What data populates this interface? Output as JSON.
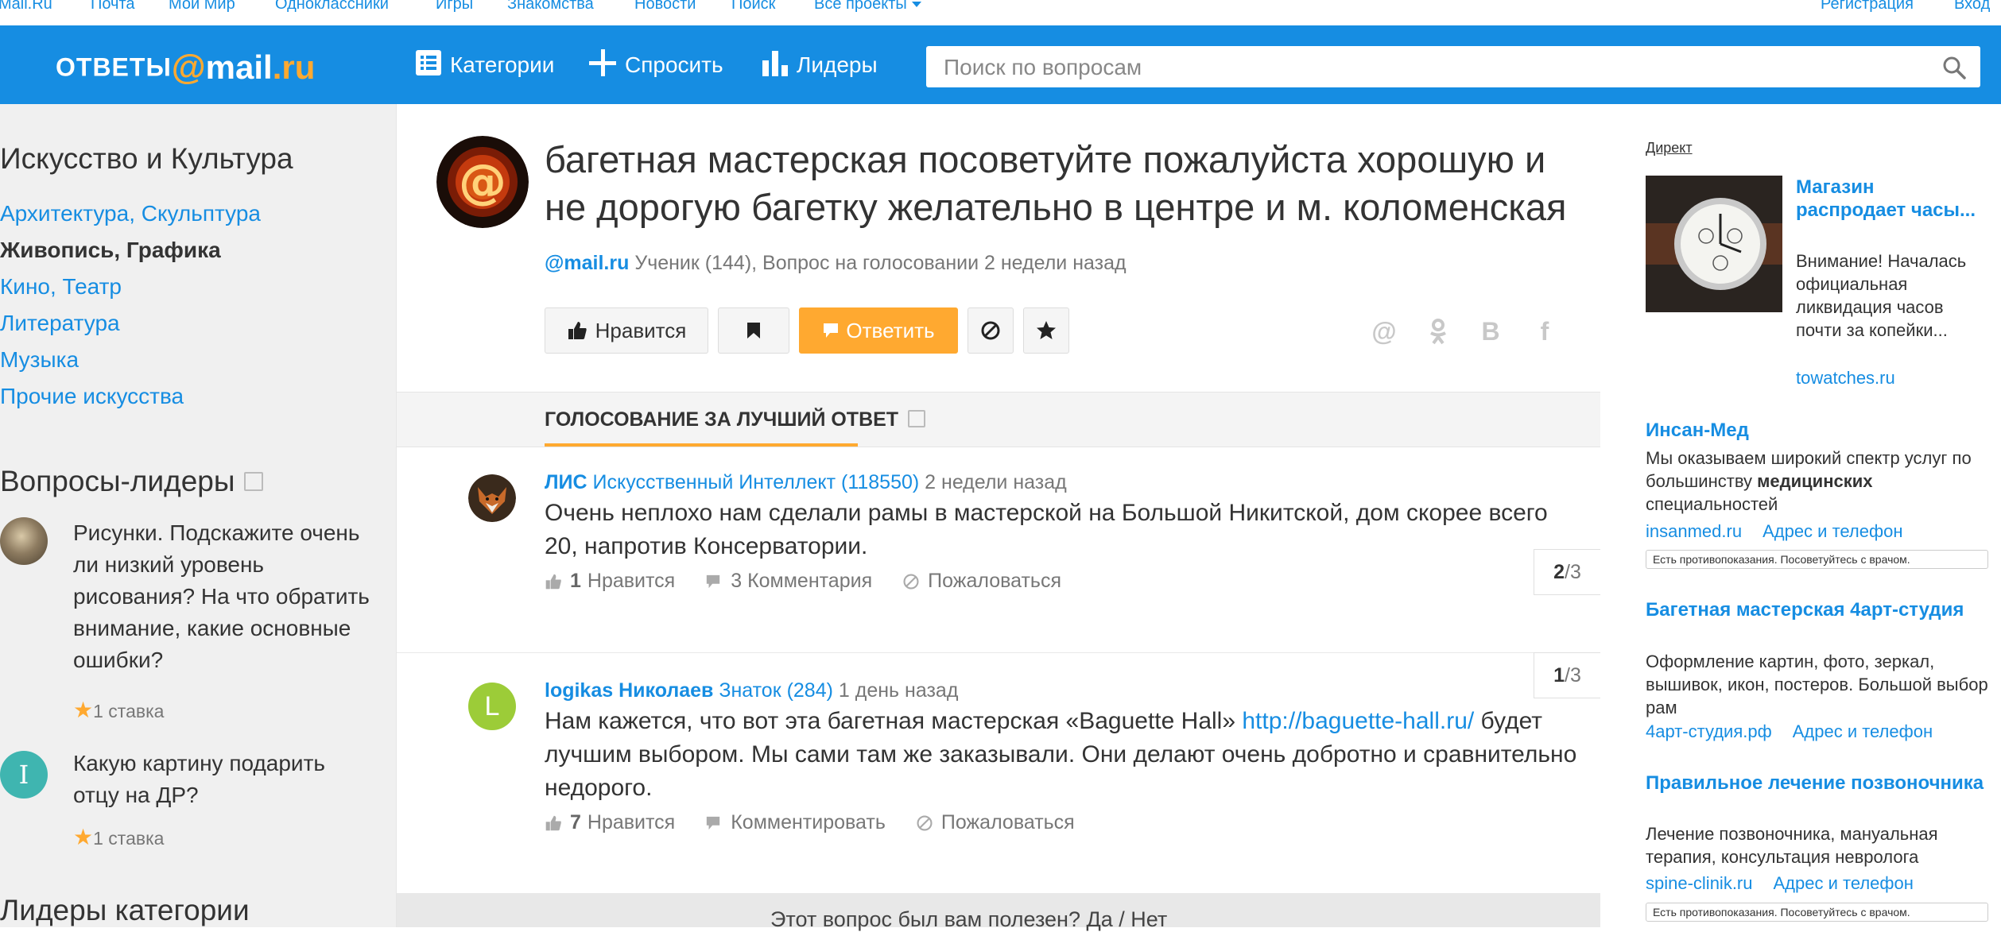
{
  "portal": {
    "links": [
      "Mail.Ru",
      "Почта",
      "Мой Мир",
      "Одноклассники",
      "Игры",
      "Знакомства",
      "Новости",
      "Поиск",
      "Все проекты"
    ],
    "register": "Регистрация",
    "login": "Вход"
  },
  "header": {
    "logo_word1": "ОТВЕТЫ",
    "logo_at": "@",
    "logo_word2": "mail",
    "logo_ru": ".ru",
    "nav": {
      "categories": "Категории",
      "ask": "Спросить",
      "leaders": "Лидеры"
    },
    "search_placeholder": "Поиск по вопросам"
  },
  "sidebar": {
    "section_title": "Искусство и Культура",
    "categories": [
      {
        "label": "Архитектура, Скульптура",
        "active": false
      },
      {
        "label": "Живопись, Графика",
        "active": true
      },
      {
        "label": "Кино, Театр",
        "active": false
      },
      {
        "label": "Литература",
        "active": false
      },
      {
        "label": "Музыка",
        "active": false
      },
      {
        "label": "Прочие искусства",
        "active": false
      }
    ],
    "leaders_title": "Вопросы-лидеры",
    "leader_questions": [
      {
        "text": "Рисунки. Подскажите очень ли низкий уровень рисования? На что обратить внимание, какие основные ошибки?",
        "bets": "1 ставка",
        "avatar_letter": ""
      },
      {
        "text": "Какую картину подарить отцу на ДР?",
        "bets": "1 ставка",
        "avatar_letter": "I"
      }
    ],
    "category_leaders_title": "Лидеры категории"
  },
  "question": {
    "title": "багетная мастерская посоветуйте пожалуйста хорошую и не дорогую багетку желательно в центре и м. коломенская",
    "author": "@mail.ru",
    "meta": "Ученик (144), Вопрос на голосовании 2 недели назад",
    "buttons": {
      "like": "Нравится",
      "answer": "Ответить"
    },
    "share_icons": [
      "@",
      "ok",
      "B",
      "f"
    ]
  },
  "voting": {
    "title": "ГОЛОСОВАНИЕ ЗА ЛУЧШИЙ ОТВЕТ"
  },
  "answers": [
    {
      "nick": "ЛИС",
      "rank": "Искусственный Интеллект (118550)",
      "time": "2 недели назад",
      "text": "Очень неплохо нам сделали рамы в мастерской на Большой Никитской, дом скорее всего 20, напротив Консерватории.",
      "link": "",
      "text_after": "",
      "likes_count": "1",
      "likes_label": "Нравится",
      "comments_label": "3 Комментария",
      "report_label": "Пожаловаться",
      "counter_num": "2",
      "counter_total": "/3",
      "avatar_letter": ""
    },
    {
      "nick": "logikas Николаев",
      "rank": "Знаток (284)",
      "time": "1 день назад",
      "text": "Нам кажется, что вот эта багетная мастерская «Baguette Hall» ",
      "link": "http://baguette-hall.ru/",
      "text_after": " будет лучшим выбором. Мы сами там же заказывали. Они делают очень добротно и сравнительно недорого.",
      "likes_count": "7",
      "likes_label": "Нравится",
      "comments_label": "Комментировать",
      "report_label": "Пожаловаться",
      "counter_num": "1",
      "counter_total": "/3",
      "avatar_letter": "L"
    }
  ],
  "helpful": "Этот вопрос был вам полезен? Да / Нет",
  "ads": {
    "direct": "Директ",
    "ad1": {
      "title": "Магазин распродает часы...",
      "text": "Внимание! Началась официальная ликвидация часов почти за копейки...",
      "url": "towatches.ru"
    },
    "items": [
      {
        "title": "Инсан-Мед",
        "text_before": "Мы оказываем широкий спектр услуг по большинству ",
        "text_bold": "медицинских",
        "text_after": " специальностей",
        "url": "insanmed.ru",
        "contacts": "Адрес и телефон",
        "warning": "Есть противопоказания. Посоветуйтесь с врачом."
      },
      {
        "title": "Багетная мастерская 4арт-студия",
        "text_before": "Оформление картин, фото, зеркал, вышивок, икон, постеров. Большой выбор рам",
        "text_bold": "",
        "text_after": "",
        "url": "4арт-студия.рф",
        "contacts": "Адрес и телефон",
        "warning": ""
      },
      {
        "title": "Правильное лечение позвоночника",
        "text_before": "Лечение позвоночника, мануальная терапия, консультация невролога",
        "text_bold": "",
        "text_after": "",
        "url": "spine-clinik.ru",
        "contacts": "Адрес и телефон",
        "warning": "Есть противопоказания. Посоветуйтесь с врачом."
      }
    ]
  },
  "colors": {
    "brand_blue": "#168de2",
    "accent_orange": "#ffa930",
    "sidebar_bg": "#f0f0f0"
  }
}
